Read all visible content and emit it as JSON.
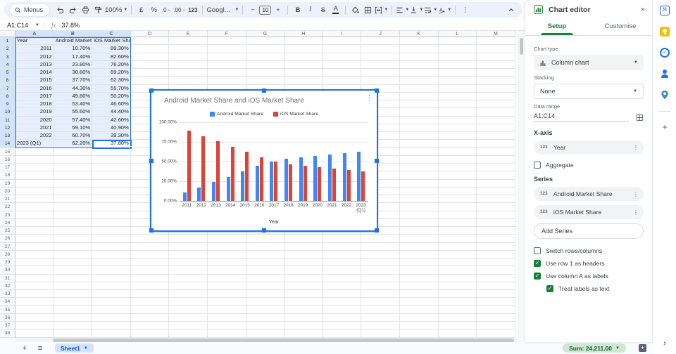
{
  "toolbar": {
    "menus_label": "Menus",
    "zoom_value": "100%",
    "currency": "£",
    "percent": "%",
    "dec_decimal": ".0",
    "inc_decimal": ".00",
    "more_formats": "123",
    "font_value": "Googl...",
    "font_size_value": "10",
    "bold": "B",
    "italic": "I",
    "strikethrough": "S",
    "text_color": "A",
    "more": "⋮"
  },
  "formula_bar": {
    "name_box": "A1:C14",
    "fx": "fx",
    "value": "37.8%"
  },
  "grid": {
    "columns": [
      "A",
      "B",
      "C",
      "D",
      "E",
      "F",
      "G",
      "H",
      "I",
      "J",
      "K",
      "L",
      "M"
    ],
    "selected_columns": [
      "A",
      "B",
      "C"
    ],
    "visible_rows": 38,
    "selected_rows": 14,
    "cells": [
      [
        "Year",
        "Android Market Share",
        "iOS Market Share"
      ],
      [
        "2011",
        "10.70%",
        "89.30%"
      ],
      [
        "2012",
        "17.40%",
        "82.60%"
      ],
      [
        "2013",
        "23.80%",
        "76.20%"
      ],
      [
        "2014",
        "30.80%",
        "69.20%"
      ],
      [
        "2015",
        "37.70%",
        "62.30%"
      ],
      [
        "2016",
        "44.30%",
        "55.70%"
      ],
      [
        "2017",
        "49.80%",
        "50.20%"
      ],
      [
        "2018",
        "53.40%",
        "46.60%"
      ],
      [
        "2019",
        "55.60%",
        "44.40%"
      ],
      [
        "2020",
        "57.40%",
        "42.60%"
      ],
      [
        "2021",
        "59.10%",
        "40.90%"
      ],
      [
        "2022",
        "60.70%",
        "39.30%"
      ],
      [
        "2023 (Q1)",
        "62.20%",
        "37.80%"
      ]
    ]
  },
  "chart_data": {
    "type": "bar",
    "title": "Android Market Share and iOS Market Share",
    "categories": [
      "2011",
      "2012",
      "2013",
      "2014",
      "2015",
      "2016",
      "2017",
      "2018",
      "2019",
      "2020",
      "2021",
      "2022",
      "2023 (Q1)"
    ],
    "series": [
      {
        "name": "Android Market Share",
        "color": "#4285f4",
        "values": [
          10.7,
          17.4,
          23.8,
          30.8,
          37.7,
          44.3,
          49.8,
          53.4,
          55.6,
          57.4,
          59.1,
          60.7,
          62.2
        ]
      },
      {
        "name": "iOS Market Share",
        "color": "#db4437",
        "values": [
          89.3,
          82.6,
          76.2,
          69.2,
          62.3,
          55.7,
          50.2,
          46.6,
          44.4,
          42.6,
          40.9,
          39.3,
          37.8
        ]
      }
    ],
    "xlabel": "Year",
    "ylim": [
      0,
      100
    ],
    "yticks": [
      "0.00%",
      "25.00%",
      "50.00%",
      "75.00%",
      "100.00%"
    ],
    "grid": true,
    "legend_position": "top"
  },
  "panel": {
    "title": "Chart editor",
    "close": "×",
    "tabs": [
      {
        "label": "Setup"
      },
      {
        "label": "Customise"
      }
    ],
    "chart_type_label": "Chart type",
    "chart_type_value": "Column chart",
    "stacking_label": "Stacking",
    "stacking_value": "None",
    "data_range_label": "Data range",
    "data_range_value": "A1:C14",
    "x_axis_label": "X-axis",
    "x_axis_chip": "Year",
    "aggregate_label": "Aggregate",
    "series_label": "Series",
    "series_chips": [
      "Android Market Share",
      "iOS Market Share"
    ],
    "add_series_label": "Add Series",
    "checkboxes": [
      {
        "label": "Switch rows/columns",
        "checked": false,
        "indent": false
      },
      {
        "label": "Use row 1 as headers",
        "checked": true,
        "indent": false
      },
      {
        "label": "Use column A as labels",
        "checked": true,
        "indent": false
      },
      {
        "label": "Treat labels as text",
        "checked": true,
        "indent": true
      }
    ]
  },
  "bottom_bar": {
    "sheet_tab": "Sheet1",
    "sum_badge": "Sum: 24,211.00"
  },
  "side_strip": {
    "icons": [
      "calendar",
      "keep",
      "tasks",
      "contacts",
      "maps",
      "get-add-ons"
    ],
    "expand": "›"
  },
  "colors": {
    "accent": "#1a73e8",
    "setup_green": "#188038",
    "series_blue": "#4285f4",
    "series_red": "#db4437"
  }
}
